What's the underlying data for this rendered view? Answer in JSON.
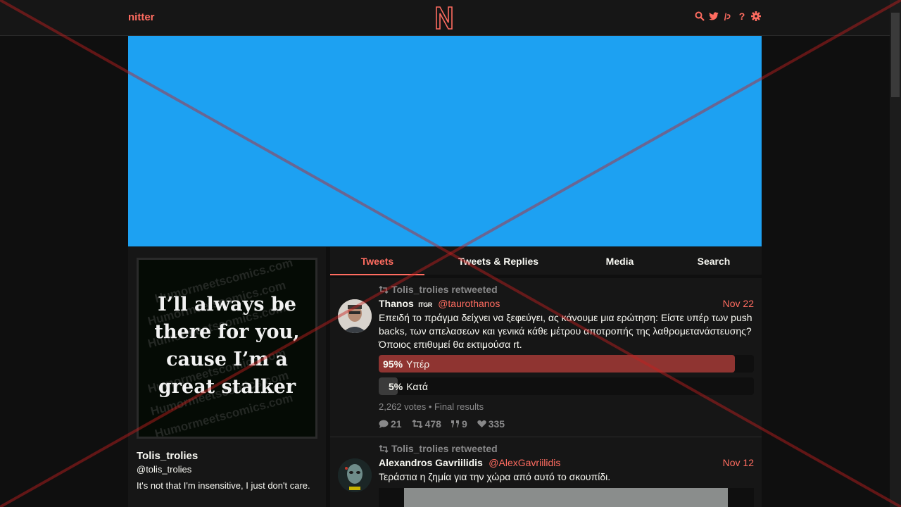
{
  "nav": {
    "brand": "nitter",
    "logo_letter": "N",
    "icons": [
      "search-icon",
      "twitter-icon",
      "rss-icon",
      "help-icon",
      "settings-icon"
    ],
    "help_glyph": "?",
    "accent": "#ff6c60"
  },
  "banner": {
    "color": "#1da1f2"
  },
  "profile": {
    "avatar_text_lines": [
      "I’ll always be",
      "there for you,",
      "cause I’m a",
      "great stalker"
    ],
    "watermark": "Humormeetscomics.com",
    "name": "Tolis_trolies",
    "handle": "@tolis_trolies",
    "bio": "It's not that I'm insensitive, I just don't care."
  },
  "tabs": [
    {
      "label": "Tweets",
      "active": true
    },
    {
      "label": "Tweets & Replies",
      "active": false
    },
    {
      "label": "Media",
      "active": false
    },
    {
      "label": "Search",
      "active": false
    }
  ],
  "tweets": [
    {
      "retweet_header": "Tolis_trolies retweeted",
      "fullname": "Thanos",
      "verified_badge": "ITGR",
      "username": "@taurothanos",
      "date": "Nov 22",
      "content": "Επειδή το πράγμα δείχνει να ξεφεύγει, ας κάνουμε μια ερώτηση: Είστε υπέρ των push backs, των απελασεων και γενικά κάθε μέτρου αποτροπής της λαθρομετανάστευσης? Όποιος επιθυμεί θα εκτιμούσα rt.",
      "poll": {
        "options": [
          {
            "percent": "95%",
            "label": "Υπέρ",
            "value": 0.95,
            "color": "#8f3431"
          },
          {
            "percent": "5%",
            "label": "Κατά",
            "value": 0.05,
            "color": "#3b3b3b"
          }
        ],
        "info": "2,262 votes • Final results"
      },
      "stats": {
        "replies": "21",
        "retweets": "478",
        "quotes": "9",
        "likes": "335"
      }
    },
    {
      "retweet_header": "Tolis_trolies retweeted",
      "fullname": "Alexandros Gavriilidis",
      "username": "@AlexGavriilidis",
      "date": "Nov 12",
      "content": "Τεράστια η ζημία για την χώρα από αυτό το σκουπίδι."
    }
  ]
}
